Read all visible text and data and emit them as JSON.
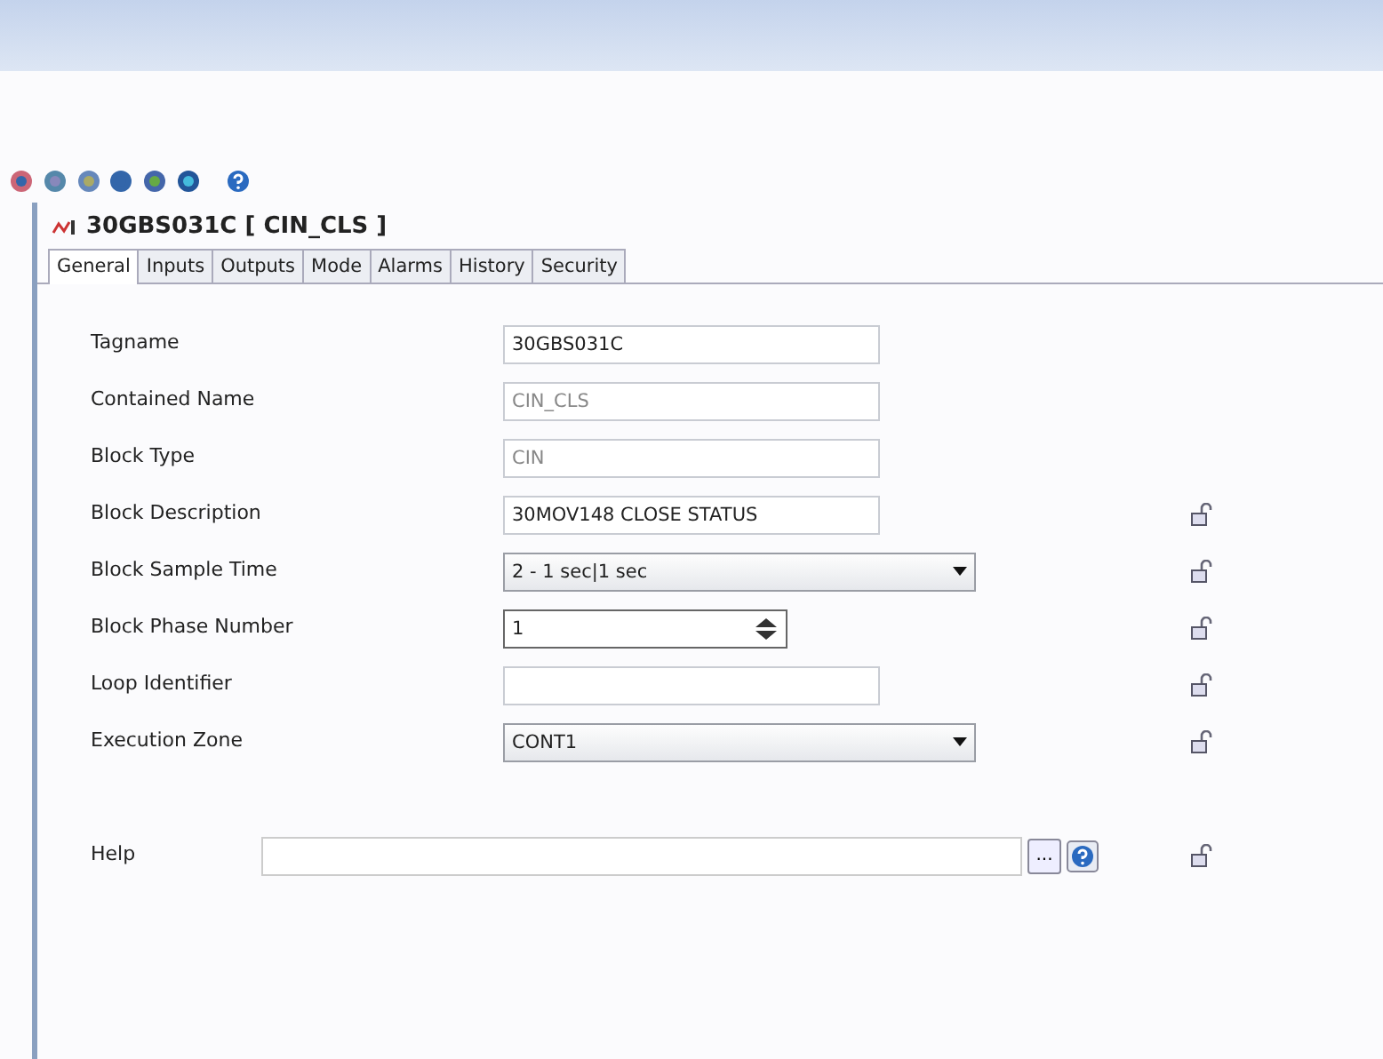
{
  "panel": {
    "title": "30GBS031C [ CIN_CLS ]"
  },
  "tabs": [
    {
      "label": "General",
      "selected": true
    },
    {
      "label": "Inputs",
      "selected": false
    },
    {
      "label": "Outputs",
      "selected": false
    },
    {
      "label": "Mode",
      "selected": false
    },
    {
      "label": "Alarms",
      "selected": false
    },
    {
      "label": "History",
      "selected": false
    },
    {
      "label": "Security",
      "selected": false
    }
  ],
  "fields": [
    {
      "label": "Tagname",
      "kind": "text",
      "value": "30GBS031C",
      "disabled": false,
      "lock": false
    },
    {
      "label": "Contained Name",
      "kind": "text",
      "value": "CIN_CLS",
      "disabled": true,
      "lock": false
    },
    {
      "label": "Block Type",
      "kind": "text",
      "value": "CIN",
      "disabled": true,
      "lock": false
    },
    {
      "label": "Block Description",
      "kind": "text",
      "value": "30MOV148 CLOSE STATUS",
      "disabled": false,
      "lock": true
    },
    {
      "label": "Block Sample Time",
      "kind": "select",
      "value": "2 - 1 sec|1 sec",
      "disabled": false,
      "lock": true
    },
    {
      "label": "Block Phase Number",
      "kind": "spinner",
      "value": "1",
      "disabled": false,
      "lock": true
    },
    {
      "label": "Loop Identifier",
      "kind": "text",
      "disabled": false,
      "lock": true
    },
    {
      "label": "Execution Zone",
      "kind": "select",
      "value": "CONT1",
      "disabled": false,
      "lock": true
    }
  ],
  "help": {
    "label": "Help",
    "browse_button": "...",
    "lock": true
  }
}
